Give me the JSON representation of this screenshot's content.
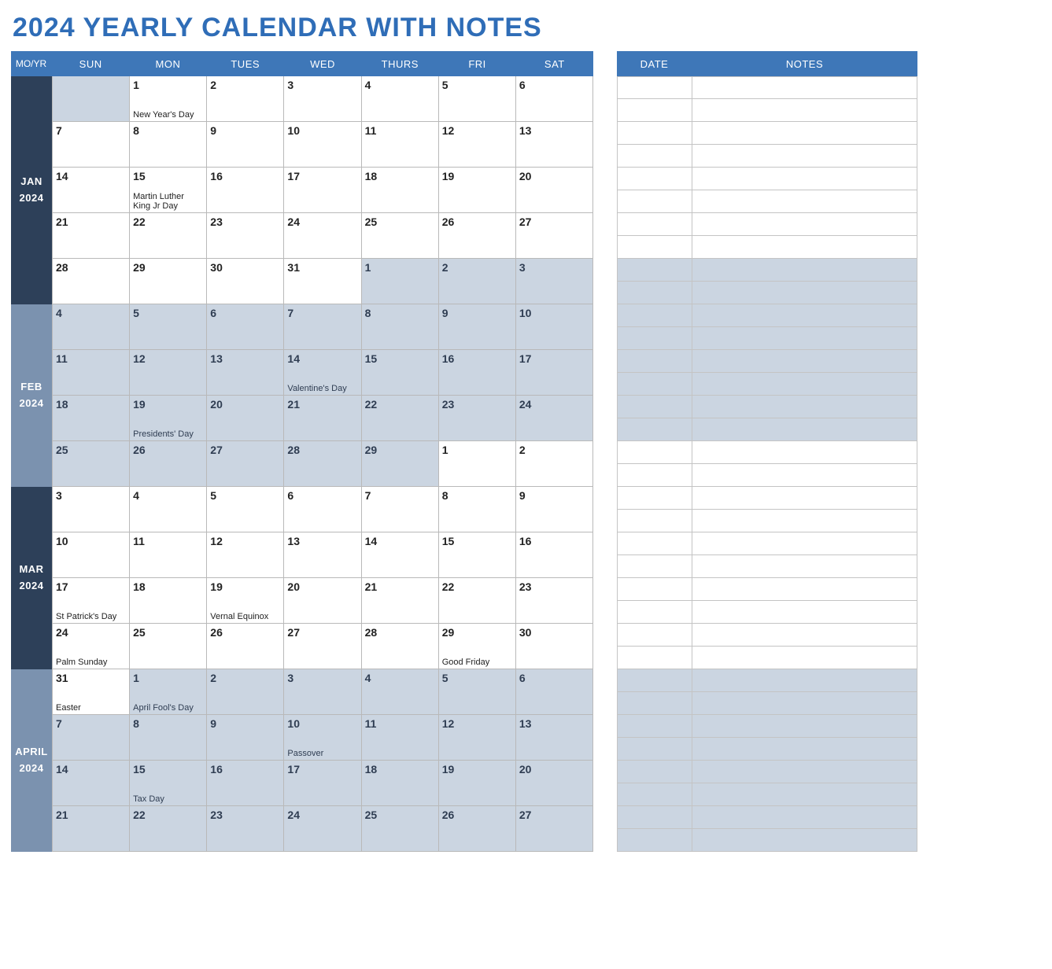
{
  "title": "2024 YEARLY CALENDAR WITH NOTES",
  "header": {
    "moyr": "MO/YR",
    "dow": [
      "SUN",
      "MON",
      "TUES",
      "WED",
      "THURS",
      "FRI",
      "SAT"
    ]
  },
  "notes_header": {
    "date": "DATE",
    "notes": "NOTES"
  },
  "months": [
    {
      "label_line1": "JAN",
      "label_line2": "2024",
      "shade": "a",
      "weeks": [
        [
          {
            "blank": true
          },
          {
            "n": "1",
            "e": "New Year's Day"
          },
          {
            "n": "2"
          },
          {
            "n": "3"
          },
          {
            "n": "4"
          },
          {
            "n": "5"
          },
          {
            "n": "6"
          }
        ],
        [
          {
            "n": "7"
          },
          {
            "n": "8"
          },
          {
            "n": "9"
          },
          {
            "n": "10"
          },
          {
            "n": "11"
          },
          {
            "n": "12"
          },
          {
            "n": "13"
          }
        ],
        [
          {
            "n": "14"
          },
          {
            "n": "15",
            "e": "Martin Luther King Jr Day"
          },
          {
            "n": "16"
          },
          {
            "n": "17"
          },
          {
            "n": "18"
          },
          {
            "n": "19"
          },
          {
            "n": "20"
          }
        ],
        [
          {
            "n": "21"
          },
          {
            "n": "22"
          },
          {
            "n": "23"
          },
          {
            "n": "24"
          },
          {
            "n": "25"
          },
          {
            "n": "26"
          },
          {
            "n": "27"
          }
        ],
        [
          {
            "n": "28"
          },
          {
            "n": "29"
          },
          {
            "n": "30"
          },
          {
            "n": "31"
          },
          {
            "n": "1",
            "alt": true
          },
          {
            "n": "2",
            "alt": true
          },
          {
            "n": "3",
            "alt": true
          }
        ]
      ],
      "note_shades": [
        false,
        false,
        false,
        false,
        false,
        false,
        false,
        false,
        true,
        true
      ]
    },
    {
      "label_line1": "FEB",
      "label_line2": "2024",
      "shade": "b",
      "weeks": [
        [
          {
            "n": "4",
            "alt": true
          },
          {
            "n": "5",
            "alt": true
          },
          {
            "n": "6",
            "alt": true
          },
          {
            "n": "7",
            "alt": true
          },
          {
            "n": "8",
            "alt": true
          },
          {
            "n": "9",
            "alt": true
          },
          {
            "n": "10",
            "alt": true
          }
        ],
        [
          {
            "n": "11",
            "alt": true
          },
          {
            "n": "12",
            "alt": true
          },
          {
            "n": "13",
            "alt": true
          },
          {
            "n": "14",
            "alt": true,
            "e": "Valentine's Day"
          },
          {
            "n": "15",
            "alt": true
          },
          {
            "n": "16",
            "alt": true
          },
          {
            "n": "17",
            "alt": true
          }
        ],
        [
          {
            "n": "18",
            "alt": true
          },
          {
            "n": "19",
            "alt": true,
            "e": "Presidents' Day"
          },
          {
            "n": "20",
            "alt": true
          },
          {
            "n": "21",
            "alt": true
          },
          {
            "n": "22",
            "alt": true
          },
          {
            "n": "23",
            "alt": true
          },
          {
            "n": "24",
            "alt": true
          }
        ],
        [
          {
            "n": "25",
            "alt": true
          },
          {
            "n": "26",
            "alt": true
          },
          {
            "n": "27",
            "alt": true
          },
          {
            "n": "28",
            "alt": true
          },
          {
            "n": "29",
            "alt": true
          },
          {
            "n": "1"
          },
          {
            "n": "2"
          }
        ]
      ],
      "note_shades": [
        true,
        true,
        true,
        true,
        true,
        true,
        false,
        false
      ]
    },
    {
      "label_line1": "MAR",
      "label_line2": "2024",
      "shade": "a",
      "weeks": [
        [
          {
            "n": "3"
          },
          {
            "n": "4"
          },
          {
            "n": "5"
          },
          {
            "n": "6"
          },
          {
            "n": "7"
          },
          {
            "n": "8"
          },
          {
            "n": "9"
          }
        ],
        [
          {
            "n": "10"
          },
          {
            "n": "11"
          },
          {
            "n": "12"
          },
          {
            "n": "13"
          },
          {
            "n": "14"
          },
          {
            "n": "15"
          },
          {
            "n": "16"
          }
        ],
        [
          {
            "n": "17",
            "e": "St Patrick's Day"
          },
          {
            "n": "18"
          },
          {
            "n": "19",
            "e": "Vernal Equinox"
          },
          {
            "n": "20"
          },
          {
            "n": "21"
          },
          {
            "n": "22"
          },
          {
            "n": "23"
          }
        ],
        [
          {
            "n": "24",
            "e": "Palm Sunday"
          },
          {
            "n": "25"
          },
          {
            "n": "26"
          },
          {
            "n": "27"
          },
          {
            "n": "28"
          },
          {
            "n": "29",
            "e": "Good Friday"
          },
          {
            "n": "30"
          }
        ]
      ],
      "note_shades": [
        false,
        false,
        false,
        false,
        false,
        false,
        false,
        false
      ]
    },
    {
      "label_line1": "APRIL",
      "label_line2": "2024",
      "shade": "b",
      "weeks": [
        [
          {
            "n": "31",
            "e": "Easter"
          },
          {
            "n": "1",
            "alt": true,
            "e": "April Fool's Day"
          },
          {
            "n": "2",
            "alt": true
          },
          {
            "n": "3",
            "alt": true
          },
          {
            "n": "4",
            "alt": true
          },
          {
            "n": "5",
            "alt": true
          },
          {
            "n": "6",
            "alt": true
          }
        ],
        [
          {
            "n": "7",
            "alt": true
          },
          {
            "n": "8",
            "alt": true
          },
          {
            "n": "9",
            "alt": true
          },
          {
            "n": "10",
            "alt": true,
            "e": "Passover"
          },
          {
            "n": "11",
            "alt": true
          },
          {
            "n": "12",
            "alt": true
          },
          {
            "n": "13",
            "alt": true
          }
        ],
        [
          {
            "n": "14",
            "alt": true
          },
          {
            "n": "15",
            "alt": true,
            "e": "Tax Day"
          },
          {
            "n": "16",
            "alt": true
          },
          {
            "n": "17",
            "alt": true
          },
          {
            "n": "18",
            "alt": true
          },
          {
            "n": "19",
            "alt": true
          },
          {
            "n": "20",
            "alt": true
          }
        ],
        [
          {
            "n": "21",
            "alt": true
          },
          {
            "n": "22",
            "alt": true
          },
          {
            "n": "23",
            "alt": true
          },
          {
            "n": "24",
            "alt": true
          },
          {
            "n": "25",
            "alt": true
          },
          {
            "n": "26",
            "alt": true
          },
          {
            "n": "27",
            "alt": true
          }
        ]
      ],
      "note_shades": [
        true,
        true,
        true,
        true,
        true,
        true,
        true,
        true
      ]
    }
  ]
}
